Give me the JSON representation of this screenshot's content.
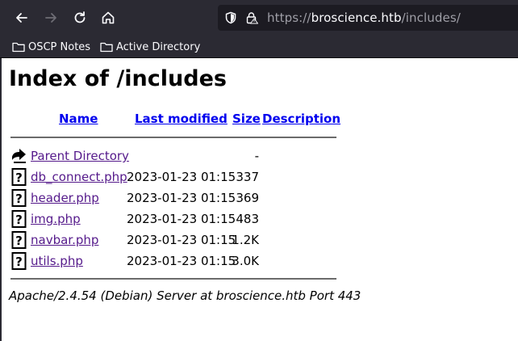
{
  "browser": {
    "back_icon": "back-arrow-icon",
    "forward_icon": "forward-arrow-icon",
    "reload_icon": "reload-icon",
    "home_icon": "home-icon",
    "url_scheme": "https://",
    "url_host": "broscience.htb",
    "url_path": "/includes/",
    "bookmarks": [
      {
        "label": "OSCP Notes",
        "icon": "folder-icon"
      },
      {
        "label": "Active Directory",
        "icon": "folder-icon"
      }
    ]
  },
  "page": {
    "title": "Index of /includes",
    "columns": {
      "name": "Name",
      "last_modified": "Last modified",
      "size": "Size",
      "description": "Description"
    },
    "parent": {
      "name": "Parent Directory",
      "size": "-"
    },
    "files": [
      {
        "name": "db_connect.php",
        "modified": "2023-01-23 01:15",
        "size": "337"
      },
      {
        "name": "header.php",
        "modified": "2023-01-23 01:15",
        "size": "369"
      },
      {
        "name": "img.php",
        "modified": "2023-01-23 01:15",
        "size": "483"
      },
      {
        "name": "navbar.php",
        "modified": "2023-01-23 01:15",
        "size": "1.2K"
      },
      {
        "name": "utils.php",
        "modified": "2023-01-23 01:15",
        "size": "3.0K"
      }
    ],
    "footer": "Apache/2.4.54 (Debian) Server at broscience.htb Port 443"
  },
  "colors": {
    "chrome": "#2b2a33",
    "urlbar": "#1c1b22",
    "link": "#0000ee",
    "visited": "#551a8b"
  }
}
